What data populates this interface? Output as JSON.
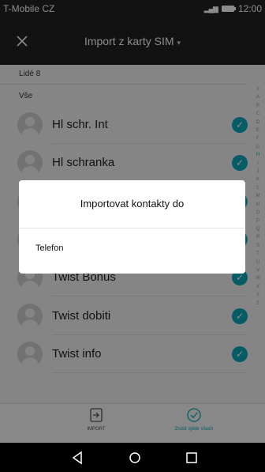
{
  "status_bar": {
    "carrier": "T-Mobile CZ",
    "time": "12:00",
    "network": "LTE"
  },
  "action_bar": {
    "close_icon": "close-icon",
    "title": "Import z karty SIM",
    "dropdown_icon": "chevron-down-icon"
  },
  "list": {
    "group_label": "Lidé 8",
    "section_label": "Vše",
    "contacts": [
      {
        "name": "Hl schr. Int",
        "checked": true
      },
      {
        "name": "Hl schranka",
        "checked": true
      },
      {
        "name": "",
        "checked": true
      },
      {
        "name": "",
        "checked": true
      },
      {
        "name": "Twist Bonus",
        "checked": true
      },
      {
        "name": "Twist dobiti",
        "checked": true
      },
      {
        "name": "Twist info",
        "checked": true
      }
    ],
    "alphabet": [
      "#",
      "A",
      "B",
      "C",
      "D",
      "E",
      "F",
      "G",
      "H",
      "I",
      "J",
      "K",
      "L",
      "M",
      "N",
      "O",
      "P",
      "Q",
      "R",
      "S",
      "T",
      "U",
      "V",
      "W",
      "X",
      "Y",
      "Z"
    ],
    "active_letter": "H"
  },
  "dialog": {
    "title": "Importovat kontakty do",
    "options": [
      "Telefon"
    ]
  },
  "toolbar": {
    "import_label": "IMPORT",
    "select_label": "Zrušit výběr všech",
    "accent": "#0aa8b8"
  },
  "navbar": {
    "back_icon": "back-icon",
    "home_icon": "home-icon",
    "recents_icon": "recents-icon"
  }
}
